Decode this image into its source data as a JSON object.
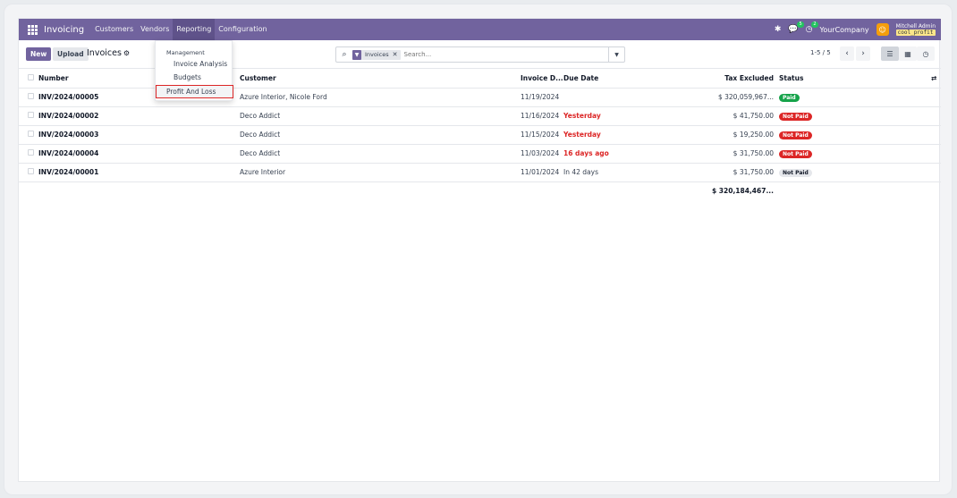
{
  "navbar": {
    "app_name": "Invoicing",
    "menus": [
      "Customers",
      "Vendors",
      "Reporting",
      "Configuration"
    ],
    "chat_count": "5",
    "activity_count": "2",
    "company": "YourCompany",
    "user_name": "Mitchell Admin",
    "database": "cool_profit"
  },
  "control_panel": {
    "new_label": "New",
    "upload_label": "Upload",
    "breadcrumb": "Invoices",
    "search_facet": "Invoices",
    "search_placeholder": "Search...",
    "pager": "1-5 / 5"
  },
  "reporting_menu": {
    "header": "Management",
    "items": [
      "Invoice Analysis",
      "Budgets",
      "Profit And Loss"
    ]
  },
  "table": {
    "headers": {
      "number": "Number",
      "customer": "Customer",
      "invoice_date": "Invoice D...",
      "due_date": "Due Date",
      "tax_excluded": "Tax Excluded",
      "status": "Status"
    },
    "rows": [
      {
        "number": "INV/2024/00005",
        "customer": "Azure Interior, Nicole Ford",
        "invoice_date": "11/19/2024",
        "due_date": "",
        "tax_excluded": "$ 320,059,967...",
        "status": "Paid"
      },
      {
        "number": "INV/2024/00002",
        "customer": "Deco Addict",
        "invoice_date": "11/16/2024",
        "due_date": "Yesterday",
        "tax_excluded": "$ 41,750.00",
        "status": "Not Paid"
      },
      {
        "number": "INV/2024/00003",
        "customer": "Deco Addict",
        "invoice_date": "11/15/2024",
        "due_date": "Yesterday",
        "tax_excluded": "$ 19,250.00",
        "status": "Not Paid"
      },
      {
        "number": "INV/2024/00004",
        "customer": "Deco Addict",
        "invoice_date": "11/03/2024",
        "due_date": "16 days ago",
        "tax_excluded": "$ 31,750.00",
        "status": "Not Paid"
      },
      {
        "number": "INV/2024/00001",
        "customer": "Azure Interior",
        "invoice_date": "11/01/2024",
        "due_date": "In 42 days",
        "tax_excluded": "$ 31,750.00",
        "status": "Not Paid"
      }
    ],
    "total": "$ 320,184,467..."
  },
  "colors": {
    "brand": "#71639e",
    "paid": "#16a34a",
    "overdue": "#dc2626"
  }
}
